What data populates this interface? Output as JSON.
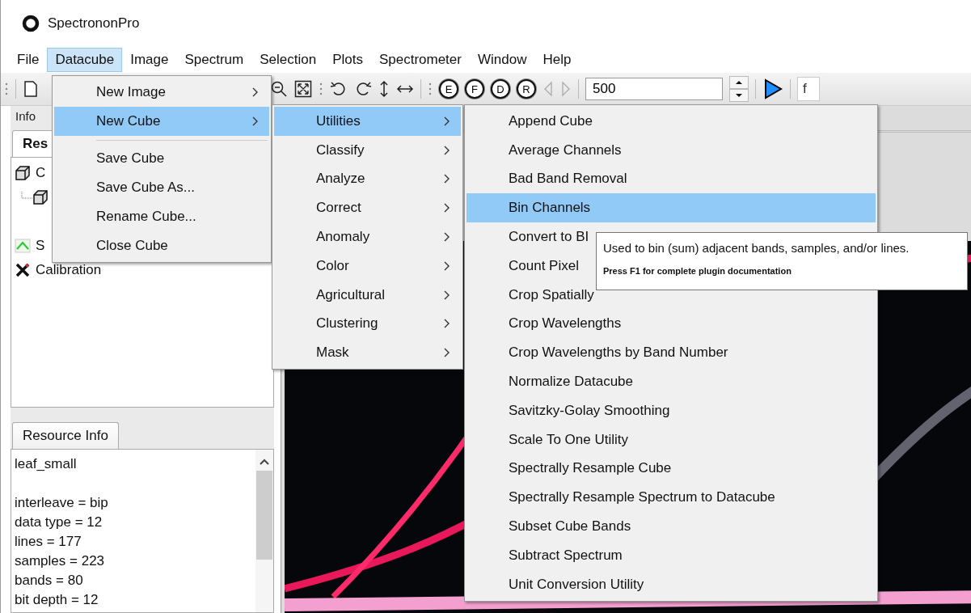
{
  "window": {
    "title": "SpectrononPro"
  },
  "menu_bar": [
    {
      "label": "File",
      "selected": false
    },
    {
      "label": "Datacube",
      "selected": true
    },
    {
      "label": "Image",
      "selected": false
    },
    {
      "label": "Spectrum",
      "selected": false
    },
    {
      "label": "Selection",
      "selected": false
    },
    {
      "label": "Plots",
      "selected": false
    },
    {
      "label": "Spectrometer",
      "selected": false
    },
    {
      "label": "Window",
      "selected": false
    },
    {
      "label": "Help",
      "selected": false
    }
  ],
  "toolbar": {
    "band_buttons": [
      "E",
      "F",
      "D",
      "R"
    ],
    "band_value": "500",
    "field_value": "f"
  },
  "left_panel": {
    "header": "Info",
    "tabs": [
      {
        "label": "Res",
        "selected": true
      }
    ],
    "tree": [
      {
        "label": "C",
        "kind": "cube",
        "children": [
          {
            "kind": "cube"
          }
        ]
      },
      {
        "label": "S",
        "kind": "spectrum"
      },
      {
        "label": "Calibration",
        "kind": "tools"
      }
    ],
    "info_tabs": [
      {
        "label": "Resource Info",
        "selected": true
      }
    ],
    "info_title": "leaf_small",
    "info_lines": [
      "interleave = bip",
      "data type = 12",
      "lines = 177",
      "samples = 223",
      "bands = 80",
      "bit depth = 12"
    ]
  },
  "menus": [
    {
      "items": [
        {
          "kind": "item",
          "label": "New Image",
          "submenu": true,
          "selected": false
        },
        {
          "kind": "item",
          "label": "New Cube",
          "submenu": true,
          "selected": true
        },
        {
          "kind": "separator"
        },
        {
          "kind": "item",
          "label": "Save Cube",
          "submenu": false,
          "selected": false
        },
        {
          "kind": "item",
          "label": "Save Cube As...",
          "submenu": false,
          "selected": false
        },
        {
          "kind": "item",
          "label": "Rename Cube...",
          "submenu": false,
          "selected": false
        },
        {
          "kind": "item",
          "label": "Close Cube",
          "submenu": false,
          "selected": false
        }
      ]
    },
    {
      "items": [
        {
          "kind": "item",
          "label": "Utilities",
          "submenu": true,
          "selected": true
        },
        {
          "kind": "item",
          "label": "Classify",
          "submenu": true,
          "selected": false
        },
        {
          "kind": "item",
          "label": "Analyze",
          "submenu": true,
          "selected": false
        },
        {
          "kind": "item",
          "label": "Correct",
          "submenu": true,
          "selected": false
        },
        {
          "kind": "item",
          "label": "Anomaly",
          "submenu": true,
          "selected": false
        },
        {
          "kind": "item",
          "label": "Color",
          "submenu": true,
          "selected": false
        },
        {
          "kind": "item",
          "label": "Agricultural",
          "submenu": true,
          "selected": false
        },
        {
          "kind": "item",
          "label": "Clustering",
          "submenu": true,
          "selected": false
        },
        {
          "kind": "item",
          "label": "Mask",
          "submenu": true,
          "selected": false
        }
      ]
    },
    {
      "items": [
        {
          "kind": "item",
          "label": "Append Cube",
          "submenu": false,
          "selected": false
        },
        {
          "kind": "item",
          "label": "Average Channels",
          "submenu": false,
          "selected": false
        },
        {
          "kind": "item",
          "label": "Bad Band Removal",
          "submenu": false,
          "selected": false
        },
        {
          "kind": "item",
          "label": "Bin Channels",
          "submenu": false,
          "selected": true
        },
        {
          "kind": "item",
          "label": "Convert to BI",
          "selected": false
        },
        {
          "kind": "item",
          "label": "Count Pixel",
          "selected": false
        },
        {
          "kind": "item",
          "label": "Crop Spatially",
          "submenu": false,
          "selected": false
        },
        {
          "kind": "item",
          "label": "Crop Wavelengths",
          "submenu": false,
          "selected": false
        },
        {
          "kind": "item",
          "label": "Crop Wavelengths by Band Number",
          "submenu": false,
          "selected": false
        },
        {
          "kind": "item",
          "label": "Normalize Datacube",
          "submenu": false,
          "selected": false
        },
        {
          "kind": "item",
          "label": "Savitzky-Golay Smoothing",
          "submenu": false,
          "selected": false
        },
        {
          "kind": "item",
          "label": "Scale To One Utility",
          "submenu": false,
          "selected": false
        },
        {
          "kind": "item",
          "label": "Spectrally Resample Cube",
          "submenu": false,
          "selected": false
        },
        {
          "kind": "item",
          "label": "Spectrally Resample Spectrum to Datacube",
          "submenu": false,
          "selected": false
        },
        {
          "kind": "item",
          "label": "Subset Cube Bands",
          "submenu": false,
          "selected": false
        },
        {
          "kind": "item",
          "label": "Subtract Spectrum",
          "submenu": false,
          "selected": false
        },
        {
          "kind": "item",
          "label": "Unit Conversion Utility",
          "submenu": false,
          "selected": false
        }
      ]
    }
  ],
  "tooltip": {
    "text": "Used to bin (sum) adjacent bands, samples, and/or lines.",
    "hint": "Press F1 for complete plugin documentation"
  }
}
